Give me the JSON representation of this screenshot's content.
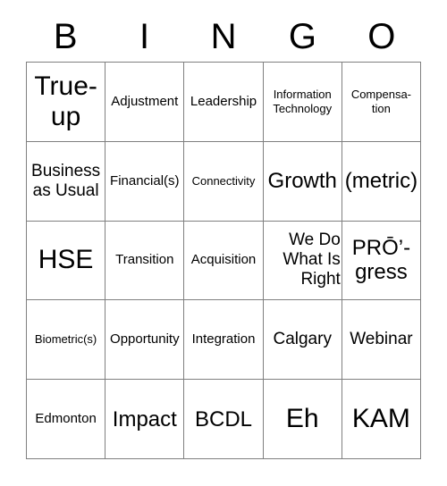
{
  "card": {
    "title": "BINGO Card",
    "header_letters": [
      "B",
      "I",
      "N",
      "G",
      "O"
    ],
    "grid_color": "#808080",
    "text_color": "#000000",
    "background_color": "#ffffff",
    "rows": [
      [
        {
          "text": "True-\nup",
          "size": "fs-xl",
          "align": "align-center"
        },
        {
          "text": "Adjustment",
          "size": "fs-sm",
          "align": "align-center"
        },
        {
          "text": "Leadership",
          "size": "fs-sm",
          "align": "align-center"
        },
        {
          "text": "Information\nTechnology",
          "size": "fs-xs",
          "align": "align-center"
        },
        {
          "text": "Compensa-\ntion",
          "size": "fs-xs",
          "align": "align-center"
        }
      ],
      [
        {
          "text": "Business\nas Usual",
          "size": "fs-md",
          "align": "align-center"
        },
        {
          "text": "Financial(s)",
          "size": "fs-sm",
          "align": "align-center"
        },
        {
          "text": "Connectivity",
          "size": "fs-xs",
          "align": "align-center"
        },
        {
          "text": "Growth",
          "size": "fs-lg",
          "align": "align-center"
        },
        {
          "text": "(metric)",
          "size": "fs-lg",
          "align": "align-center"
        }
      ],
      [
        {
          "text": "HSE",
          "size": "fs-xl",
          "align": "align-center"
        },
        {
          "text": "Transition",
          "size": "fs-sm",
          "align": "align-center"
        },
        {
          "text": "Acquisition",
          "size": "fs-sm",
          "align": "align-center"
        },
        {
          "text": "We Do\nWhat Is\nRight",
          "size": "fs-md",
          "align": "align-right"
        },
        {
          "text": "PRŌ’-\ngress",
          "size": "fs-lg",
          "align": "align-center"
        }
      ],
      [
        {
          "text": "Biometric(s)",
          "size": "fs-xs",
          "align": "align-center"
        },
        {
          "text": "Opportunity",
          "size": "fs-sm",
          "align": "align-center"
        },
        {
          "text": "Integration",
          "size": "fs-sm",
          "align": "align-center"
        },
        {
          "text": "Calgary",
          "size": "fs-md",
          "align": "align-center"
        },
        {
          "text": "Webinar",
          "size": "fs-md",
          "align": "align-center"
        }
      ],
      [
        {
          "text": "Edmonton",
          "size": "fs-sm",
          "align": "align-center"
        },
        {
          "text": "Impact",
          "size": "fs-lg",
          "align": "align-center"
        },
        {
          "text": "BCDL",
          "size": "fs-lg",
          "align": "align-center"
        },
        {
          "text": "Eh",
          "size": "fs-xl",
          "align": "align-center"
        },
        {
          "text": "KAM",
          "size": "fs-xl",
          "align": "align-center"
        }
      ]
    ]
  }
}
